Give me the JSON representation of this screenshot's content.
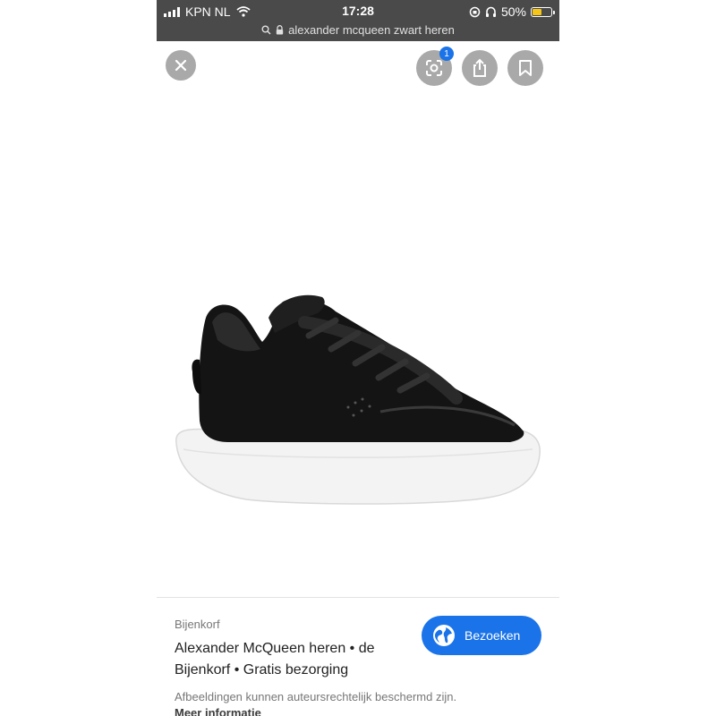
{
  "status_bar": {
    "carrier": "KPN NL",
    "time": "17:28",
    "battery": "50%",
    "battery_level": 0.5,
    "battery_color": "#f5c518"
  },
  "address_bar": {
    "query": "alexander mcqueen zwart heren",
    "search_icon": "search-icon",
    "lock_icon": "lock-icon"
  },
  "toolbar": {
    "close_icon": "close-icon",
    "lens_icon": "lens-icon",
    "lens_badge": "1",
    "share_icon": "share-icon",
    "save_icon": "bookmark-icon"
  },
  "result": {
    "source": "Bijenkorf",
    "title": "Alexander McQueen heren • de Bijenkorf • Gratis bezorging",
    "visit_label": "Bezoeken",
    "visit_icon": "globe-icon",
    "copyright_notice": "Afbeeldingen kunnen auteursrechtelijk beschermd zijn.",
    "more_info": "Meer informatie"
  },
  "colors": {
    "accent": "#1a73e8",
    "status_bar_bg": "#4a4a4a"
  }
}
